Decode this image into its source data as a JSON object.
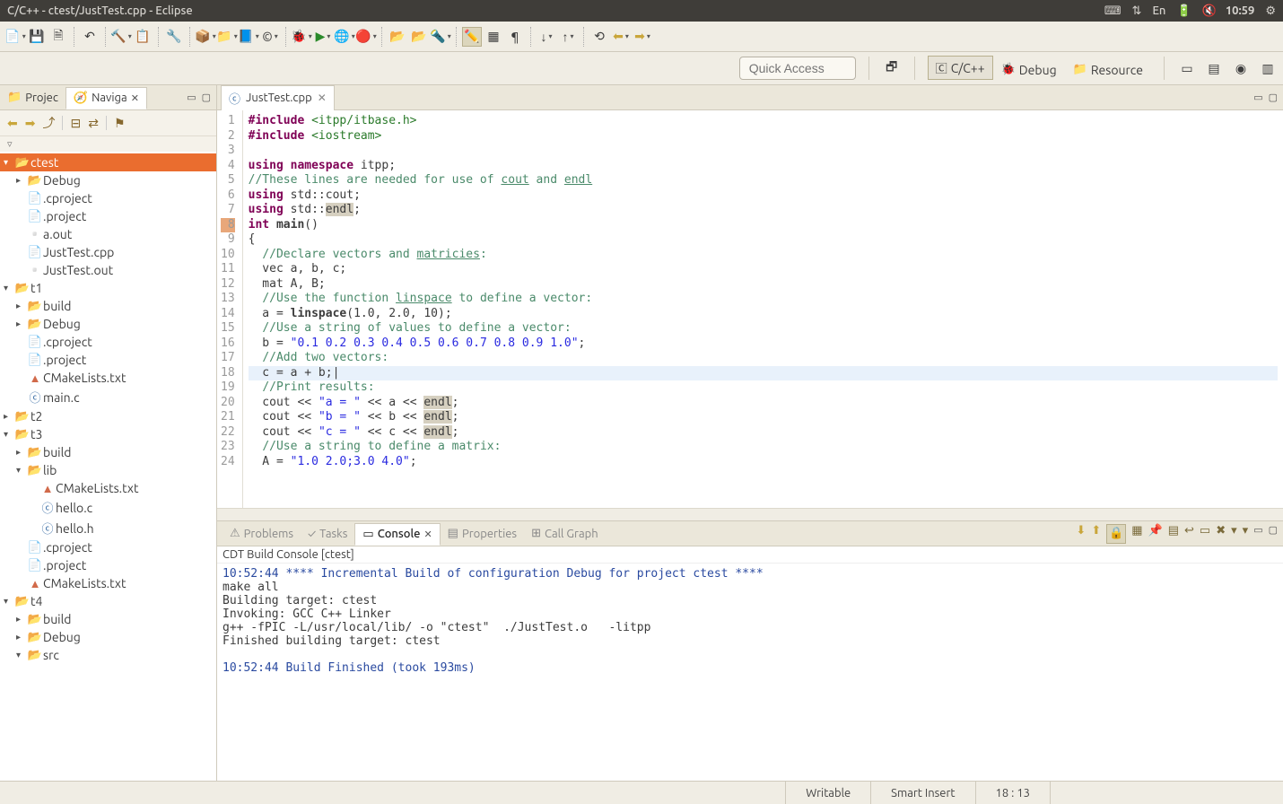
{
  "titlebar": {
    "title": "C/C++ - ctest/JustTest.cpp - Eclipse",
    "clock": "10:59",
    "lang": "En"
  },
  "quick_access": {
    "placeholder": "Quick Access"
  },
  "perspectives": [
    {
      "label": "C/C++",
      "active": true
    },
    {
      "label": "Debug",
      "active": false
    },
    {
      "label": "Resource",
      "active": false
    }
  ],
  "sidebar": {
    "tabs": {
      "project": "Projec",
      "navigator": "Naviga"
    },
    "tree": [
      {
        "label": "ctest",
        "indent": 0,
        "icon": "folder",
        "twisty": "▾",
        "selected": true
      },
      {
        "label": "Debug",
        "indent": 1,
        "icon": "folder",
        "twisty": "▸"
      },
      {
        "label": ".cproject",
        "indent": 1,
        "icon": "file"
      },
      {
        "label": ".project",
        "indent": 1,
        "icon": "file"
      },
      {
        "label": "a.out",
        "indent": 1,
        "icon": "bin"
      },
      {
        "label": "JustTest.cpp",
        "indent": 1,
        "icon": "file"
      },
      {
        "label": "JustTest.out",
        "indent": 1,
        "icon": "bin"
      },
      {
        "label": "t1",
        "indent": 0,
        "icon": "folder",
        "twisty": "▾"
      },
      {
        "label": "build",
        "indent": 1,
        "icon": "folder",
        "twisty": "▸"
      },
      {
        "label": "Debug",
        "indent": 1,
        "icon": "folder",
        "twisty": "▸"
      },
      {
        "label": ".cproject",
        "indent": 1,
        "icon": "file"
      },
      {
        "label": ".project",
        "indent": 1,
        "icon": "file"
      },
      {
        "label": "CMakeLists.txt",
        "indent": 1,
        "icon": "cmake"
      },
      {
        "label": "main.c",
        "indent": 1,
        "icon": "cfile"
      },
      {
        "label": "t2",
        "indent": 0,
        "icon": "folder",
        "twisty": "▸"
      },
      {
        "label": "t3",
        "indent": 0,
        "icon": "folder",
        "twisty": "▾"
      },
      {
        "label": "build",
        "indent": 1,
        "icon": "folder",
        "twisty": "▸"
      },
      {
        "label": "lib",
        "indent": 1,
        "icon": "folder",
        "twisty": "▾"
      },
      {
        "label": "CMakeLists.txt",
        "indent": 2,
        "icon": "cmake"
      },
      {
        "label": "hello.c",
        "indent": 2,
        "icon": "cfile"
      },
      {
        "label": "hello.h",
        "indent": 2,
        "icon": "cfile"
      },
      {
        "label": ".cproject",
        "indent": 1,
        "icon": "file"
      },
      {
        "label": ".project",
        "indent": 1,
        "icon": "file"
      },
      {
        "label": "CMakeLists.txt",
        "indent": 1,
        "icon": "cmake"
      },
      {
        "label": "t4",
        "indent": 0,
        "icon": "folder",
        "twisty": "▾"
      },
      {
        "label": "build",
        "indent": 1,
        "icon": "folder",
        "twisty": "▸"
      },
      {
        "label": "Debug",
        "indent": 1,
        "icon": "folder",
        "twisty": "▸"
      },
      {
        "label": "src",
        "indent": 1,
        "icon": "folder",
        "twisty": "▾"
      }
    ]
  },
  "editor": {
    "tab": "JustTest.cpp",
    "lines": [
      {
        "n": 1,
        "html": "<span class='kw'>#include</span> <span class='inc'>&lt;itpp/itbase.h&gt;</span>"
      },
      {
        "n": 2,
        "html": "<span class='kw'>#include</span> <span class='inc'>&lt;iostream&gt;</span>"
      },
      {
        "n": 3,
        "html": ""
      },
      {
        "n": 4,
        "html": "<span class='kw'>using</span> <span class='kw'>namespace</span> itpp;"
      },
      {
        "n": 5,
        "html": "<span class='cm'>//These lines are needed for use of <span class='ul'>cout</span> and <span class='ul'>endl</span></span>"
      },
      {
        "n": 6,
        "html": "<span class='kw'>using</span> std::cout;"
      },
      {
        "n": 7,
        "html": "<span class='kw'>using</span> std::<span class='mark'>endl</span>;"
      },
      {
        "n": 8,
        "html": "<span class='kw'>int</span> <span class='fn'>main</span>()",
        "marker": true
      },
      {
        "n": 9,
        "html": "{"
      },
      {
        "n": 10,
        "html": "  <span class='cm'>//Declare vectors and <span class='ul'>matricies</span>:</span>"
      },
      {
        "n": 11,
        "html": "  vec a, b, c;"
      },
      {
        "n": 12,
        "html": "  mat A, B;"
      },
      {
        "n": 13,
        "html": "  <span class='cm'>//Use the function <span class='ul'>linspace</span> to define a vector:</span>"
      },
      {
        "n": 14,
        "html": "  a = <span class='fn'>linspace</span>(1.0, 2.0, 10);"
      },
      {
        "n": 15,
        "html": "  <span class='cm'>//Use a string of values to define a vector:</span>"
      },
      {
        "n": 16,
        "html": "  b = <span class='str'>\"0.1 0.2 0.3 0.4 0.5 0.6 0.7 0.8 0.9 1.0\"</span>;"
      },
      {
        "n": 17,
        "html": "  <span class='cm'>//Add two vectors:</span>"
      },
      {
        "n": 18,
        "html": "  c = a + b;|",
        "hl": true
      },
      {
        "n": 19,
        "html": "  <span class='cm'>//Print results:</span>"
      },
      {
        "n": 20,
        "html": "  cout &lt;&lt; <span class='str'>\"a = \"</span> &lt;&lt; a &lt;&lt; <span class='mark'>endl</span>;"
      },
      {
        "n": 21,
        "html": "  cout &lt;&lt; <span class='str'>\"b = \"</span> &lt;&lt; b &lt;&lt; <span class='mark'>endl</span>;"
      },
      {
        "n": 22,
        "html": "  cout &lt;&lt; <span class='str'>\"c = \"</span> &lt;&lt; c &lt;&lt; <span class='mark'>endl</span>;"
      },
      {
        "n": 23,
        "html": "  <span class='cm'>//Use a string to define a matrix:</span>"
      },
      {
        "n": 24,
        "html": "  A = <span class='str'>\"1.0 2.0;3.0 4.0\"</span>;"
      }
    ]
  },
  "bottom": {
    "tabs": [
      "Problems",
      "Tasks",
      "Console",
      "Properties",
      "Call Graph"
    ],
    "active": "Console",
    "console_head": "CDT Build Console [ctest]",
    "console_lines": [
      {
        "text": "10:52:44 **** Incremental Build of configuration Debug for project ctest ****",
        "cls": "blue"
      },
      {
        "text": "make all",
        "cls": ""
      },
      {
        "text": "Building target: ctest",
        "cls": ""
      },
      {
        "text": "Invoking: GCC C++ Linker",
        "cls": ""
      },
      {
        "text": "g++ -fPIC -L/usr/local/lib/ -o \"ctest\"  ./JustTest.o   -litpp",
        "cls": ""
      },
      {
        "text": "Finished building target: ctest",
        "cls": ""
      },
      {
        "text": " ",
        "cls": ""
      },
      {
        "text": "",
        "cls": ""
      },
      {
        "text": "10:52:44 Build Finished (took 193ms)",
        "cls": "blue"
      }
    ]
  },
  "status": {
    "writable": "Writable",
    "insert": "Smart Insert",
    "pos": "18 : 13"
  }
}
